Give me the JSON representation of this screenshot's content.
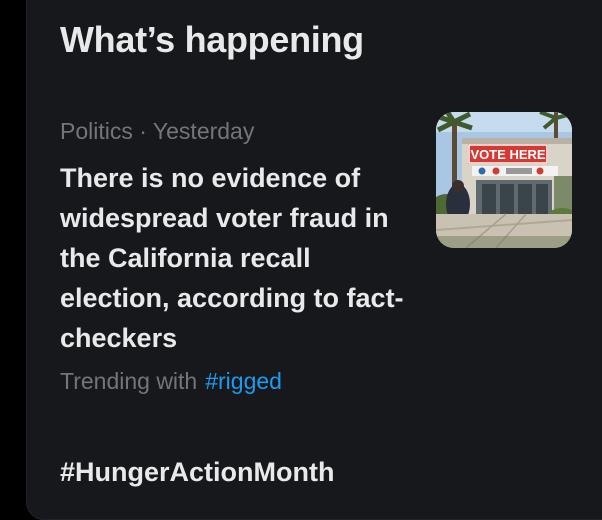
{
  "section": {
    "title": "What’s happening"
  },
  "trends": [
    {
      "category": "Politics",
      "separator": "·",
      "time": "Yesterday",
      "headline": "There is no evidence of widespread voter fraud in the California recall election, according to fact-checkers",
      "trending_with_label": "Trending with",
      "hashtag": "#rigged",
      "image": {
        "sign_text": "VOTE HERE"
      }
    },
    {
      "headline": "#HungerActionMonth"
    }
  ],
  "colors": {
    "background": "#000000",
    "panel": "#16181c",
    "primary_text": "#e7e9ea",
    "secondary_text": "#71767b",
    "link": "#1d9bf0"
  }
}
